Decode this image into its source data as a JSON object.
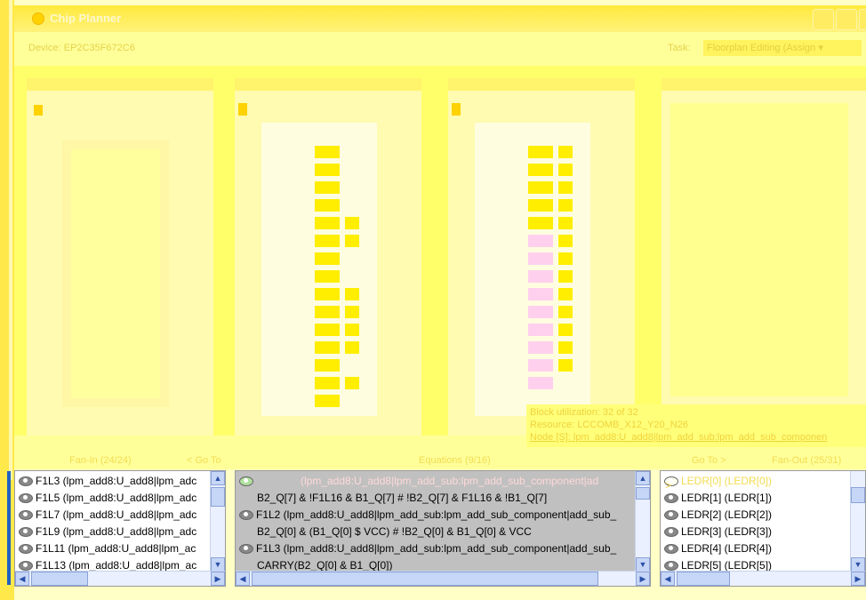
{
  "window": {
    "title": "Chip Planner"
  },
  "header": {
    "device": "Device: EP2C35F672C6",
    "task_label": "Task:",
    "task_value": "Floorplan Editing (Assign"
  },
  "tooltip": {
    "line1": "Block utilization: 32 of 32",
    "line2": "Resource: LCCOMB_X12_Y20_N26",
    "line3": "Node [S]: lpm_add8:U_add8|lpm_add_sub:lpm_add_sub_componen"
  },
  "nav": {
    "fanin": "Fan-In (24/24)",
    "goto_left": "< Go To",
    "equations": "Equations (9/16)",
    "goto_right": "Go To >",
    "fanout": "Fan-Out (25/31)"
  },
  "fanin_list": [
    "F1L3 (lpm_add8:U_add8|lpm_adc",
    "F1L5 (lpm_add8:U_add8|lpm_adc",
    "F1L7 (lpm_add8:U_add8|lpm_adc",
    "F1L9 (lpm_add8:U_add8|lpm_adc",
    "F1L11 (lpm_add8:U_add8|lpm_ac",
    "F1L13 (lpm_add8:U_add8|lpm_ac"
  ],
  "equations": {
    "header": "(lpm_add8:U_add8|lpm_add_sub:lpm_add_sub_component|ad",
    "lines": [
      "B2_Q[7] & !F1L16 & B1_Q[7] # !B2_Q[7] & F1L16 & !B1_Q[7]",
      "F1L2 (lpm_add8:U_add8|lpm_add_sub:lpm_add_sub_component|add_sub_",
      "B2_Q[0] & (B1_Q[0] $ VCC) # !B2_Q[0] & B1_Q[0] & VCC",
      "F1L3 (lpm_add8:U_add8|lpm_add_sub:lpm_add_sub_component|add_sub_",
      "CARRY(B2_Q[0] & B1_Q[0])"
    ]
  },
  "fanout_list": {
    "header": "LEDR[0] (LEDR[0])",
    "items": [
      "LEDR[1] (LEDR[1])",
      "LEDR[2] (LEDR[2])",
      "LEDR[3] (LEDR[3])",
      "LEDR[4] (LEDR[4])",
      "LEDR[5] (LEDR[5])"
    ]
  },
  "colors": {
    "highlight": "#ffee00",
    "selected_cell": "#ffd0ee",
    "background": "#ffff6a"
  }
}
